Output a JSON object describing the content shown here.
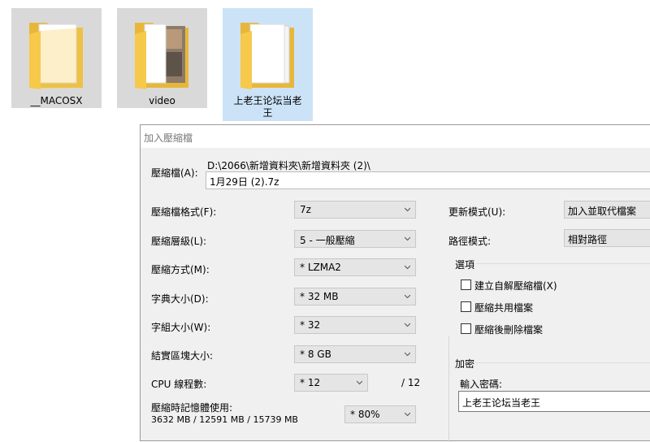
{
  "desktop": {
    "icons": [
      {
        "label": "__MACOSX"
      },
      {
        "label": "video"
      },
      {
        "label_line1": "上老王论坛当老",
        "label_line2": "王"
      }
    ]
  },
  "dialog": {
    "title": "加入壓縮檔",
    "archive_label": "壓縮檔(A):",
    "archive_path": "D:\\2066\\新增資料夾\\新增資料夾 (2)\\",
    "archive_name": "1月29日 (2).7z",
    "left": {
      "format_label": "壓縮檔格式(F):",
      "format_value": "7z",
      "level_label": "壓縮層級(L):",
      "level_value": "5 - 一般壓縮",
      "method_label": "壓縮方式(M):",
      "method_value": "* LZMA2",
      "dict_label": "字典大小(D):",
      "dict_value": "* 32 MB",
      "word_label": "字組大小(W):",
      "word_value": "* 32",
      "solid_label": "結實區塊大小:",
      "solid_value": "* 8 GB",
      "cpu_label": "CPU 線程數:",
      "cpu_value": "* 12",
      "cpu_total": "/ 12",
      "mem_label": "壓縮時記憶體使用:",
      "mem_detail": "3632 MB / 12591 MB / 15739 MB",
      "mem_value": "* 80%"
    },
    "right": {
      "update_label": "更新模式(U):",
      "update_value": "加入並取代檔案",
      "path_label": "路徑模式:",
      "path_value": "相對路徑",
      "options_title": "選項",
      "opt_sfx": "建立自解壓縮檔(X)",
      "opt_shared": "壓縮共用檔案",
      "opt_delete": "壓縮後刪除檔案",
      "encrypt_title": "加密",
      "password_label": "輸入密碼:",
      "password_value": "上老王论坛当老王"
    }
  }
}
